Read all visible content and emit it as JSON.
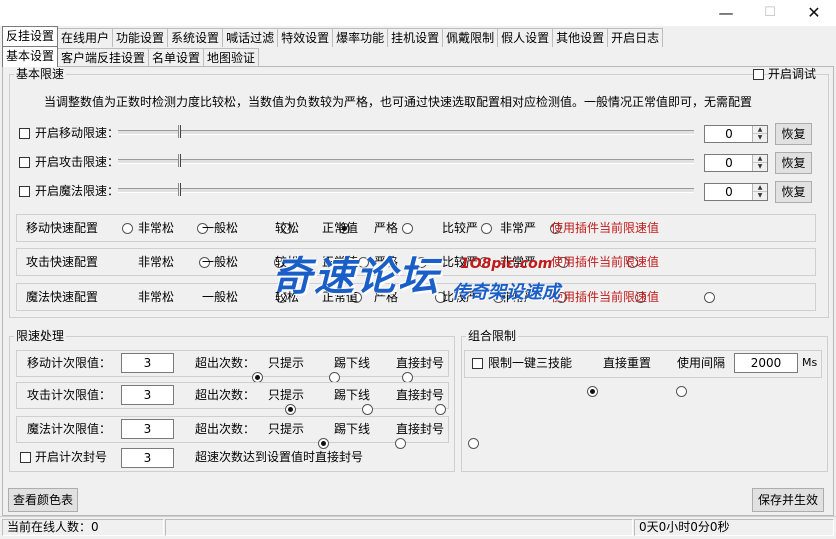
{
  "window": {
    "minimize": "—",
    "maximize": "☐",
    "close": "✕"
  },
  "main_tabs": [
    {
      "label": "反挂设置"
    },
    {
      "label": "在线用户"
    },
    {
      "label": "功能设置"
    },
    {
      "label": "系统设置"
    },
    {
      "label": "喊话过滤"
    },
    {
      "label": "特效设置"
    },
    {
      "label": "爆率功能"
    },
    {
      "label": "挂机设置"
    },
    {
      "label": "佩戴限制"
    },
    {
      "label": "假人设置"
    },
    {
      "label": "其他设置"
    },
    {
      "label": "开启日志"
    }
  ],
  "sub_tabs": [
    {
      "label": "基本设置"
    },
    {
      "label": "客户端反挂设置"
    },
    {
      "label": "名单设置"
    },
    {
      "label": "地图验证"
    }
  ],
  "basic_limit": {
    "title": "基本限速",
    "debug_label": "开启调试",
    "hint": "当调整数值为正数时检测力度比较松，当数值为负数较为严格，也可通过快速选取配置相对应检测值。一般情况正常值即可，无需配置",
    "sliders": [
      {
        "label": "开启移动限速：",
        "value": "0",
        "restore": "恢复"
      },
      {
        "label": "开启攻击限速：",
        "value": "0",
        "restore": "恢复"
      },
      {
        "label": "开启魔法限速：",
        "value": "0",
        "restore": "恢复"
      }
    ],
    "quick_rows": [
      {
        "label": "移动快速配置",
        "note": "使用插件当前限速值",
        "selected": 3
      },
      {
        "label": "攻击快速配置",
        "note": "使用插件当前限速值",
        "selected": -1
      },
      {
        "label": "魔法快速配置",
        "note": "使用插件当前限速值",
        "selected": -1
      }
    ],
    "quick_options": [
      "非常松",
      "一般松",
      "较松",
      "正常值",
      "严格",
      "比较严",
      "非常严"
    ]
  },
  "speed_handling": {
    "title": "限速处理",
    "rows": [
      {
        "label": "移动计次限值：",
        "value": "3",
        "exceed": "超出次数：",
        "selected": 0
      },
      {
        "label": "攻击计次限值：",
        "value": "3",
        "exceed": "超出次数：",
        "selected": 0
      },
      {
        "label": "魔法计次限值：",
        "value": "3",
        "exceed": "超出次数：",
        "selected": 0
      }
    ],
    "options": [
      "只提示",
      "踢下线",
      "直接封号"
    ],
    "count_ban": {
      "label": "开启计次封号",
      "value": "3",
      "desc": "超速次数达到设置值时直接封号"
    }
  },
  "combo_limit": {
    "title": "组合限制",
    "checkbox_label": "限制一键三技能",
    "options": [
      "直接重置",
      "使用间隔"
    ],
    "selected": 0,
    "interval_value": "2000",
    "unit": "Ms"
  },
  "buttons": {
    "view_colors": "查看颜色表",
    "save": "保存并生效"
  },
  "status": {
    "online": "当前在线人数：0",
    "uptime": "0天0小时0分0秒"
  },
  "watermark": {
    "main": "奇速论坛",
    "domain": "1O8pic.com",
    "sub": "传奇架设速成"
  },
  "colors": {
    "window_bg": "#f0f0f0",
    "note_red": "#c21a1a",
    "watermark_blue": "#1a5fc8"
  }
}
